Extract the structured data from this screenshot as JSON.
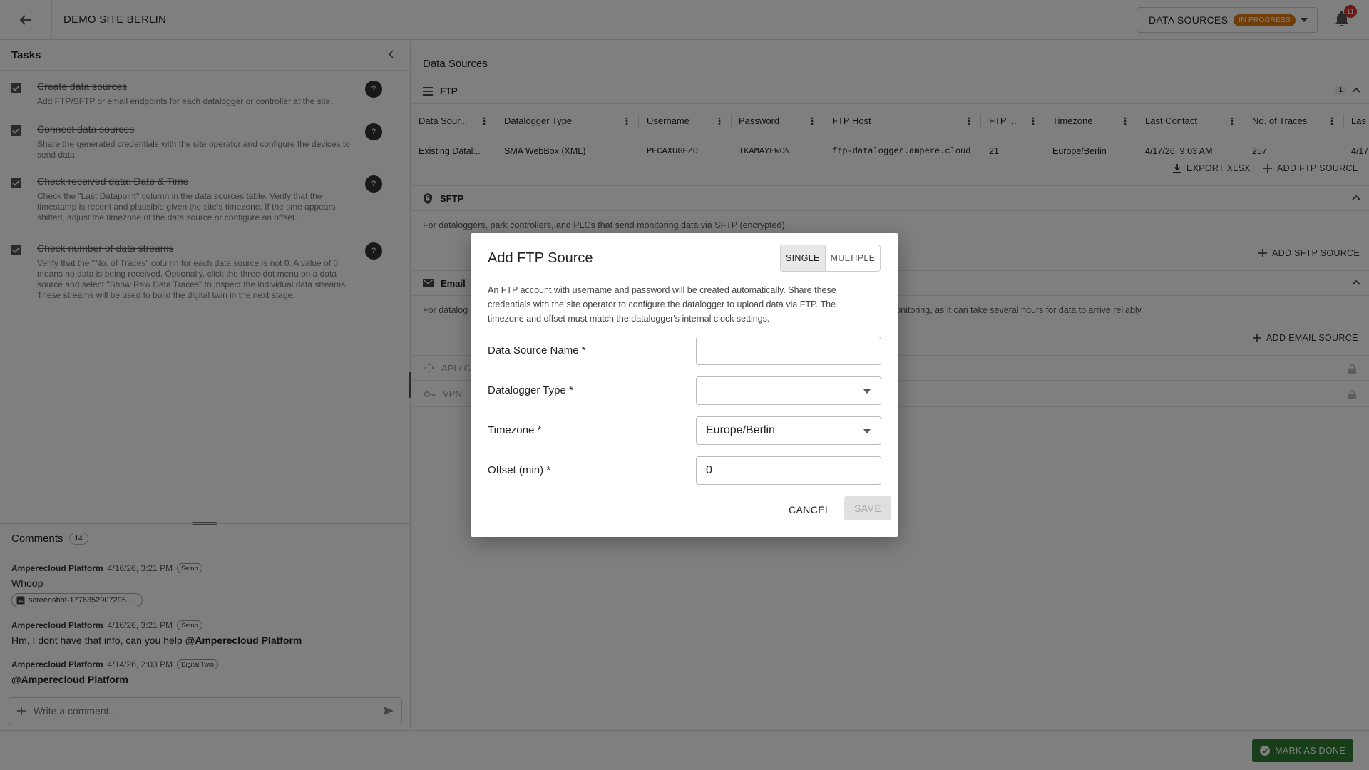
{
  "header": {
    "site_title": "DEMO SITE BERLIN",
    "stage_label": "DATA SOURCES",
    "stage_status": "IN PROGRESS",
    "notification_count": "11"
  },
  "tasks_panel": {
    "title": "Tasks",
    "items": [
      {
        "title": "Create data sources",
        "description": "Add FTP/SFTP or email endpoints for each datalogger or controller at the site.",
        "done": true
      },
      {
        "title": "Connect data sources",
        "description": "Share the generated credentials with the site operator and configure the devices to send data.",
        "done": true
      },
      {
        "title": "Check received data: Date & Time",
        "description": "Check the \"Last Datapoint\" column in the data sources table. Verify that the timestamp is recent and plausible given the site's timezone. If the time appears shifted, adjust the timezone of the data source or configure an offset.",
        "done": true
      },
      {
        "title": "Check number of data streams",
        "description": "Verify that the \"No. of Traces\" column for each data source is not 0. A value of 0 means no data is being received. Optionally, click the three-dot menu on a data source and select \"Show Raw Data Traces\" to inspect the individual data streams. These streams will be used to build the digital twin in the next stage.",
        "done": true
      }
    ],
    "help_glyph": "?"
  },
  "comments": {
    "title": "Comments",
    "count": "14",
    "items": [
      {
        "author": "Amperecloud Platform",
        "time": "4/16/26, 3:21 PM",
        "tag": "Setup",
        "text": "Whoop",
        "attachment": "screenshot-1776352907295...."
      },
      {
        "author": "Amperecloud Platform",
        "time": "4/16/26, 3:21 PM",
        "tag": "Setup",
        "text": "Hm, I dont have that info, can you help ",
        "mention": "@Amperecloud Platform"
      },
      {
        "author": "Amperecloud Platform",
        "time": "4/14/26, 2:03 PM",
        "tag": "Digital Twin",
        "mention": "@Amperecloud Platform"
      }
    ],
    "input_placeholder": "Write a comment..."
  },
  "data_sources": {
    "title": "Data Sources",
    "ftp": {
      "label": "FTP",
      "count": "1",
      "columns": [
        "Data Sour...",
        "Datalogger Type",
        "Username",
        "Password",
        "FTP Host",
        "FTP ...",
        "Timezone",
        "Last Contact",
        "No. of Traces",
        "Las"
      ],
      "rows": [
        [
          "Existing Datal...",
          "SMA WebBox (XML)",
          "PECAXUGEZO",
          "IKAMAYEWON",
          "ftp-datalogger.ampere.cloud",
          "21",
          "Europe/Berlin",
          "4/17/26, 9:03 AM",
          "257",
          "4/17"
        ]
      ],
      "export_label": "EXPORT XLSX",
      "add_label": "ADD FTP SOURCE"
    },
    "sftp": {
      "label": "SFTP",
      "description": "For dataloggers, park controllers, and PLCs that send monitoring data via SFTP (encrypted).",
      "add_label": "ADD SFTP SOURCE"
    },
    "email": {
      "label": "Email",
      "description_start": "For datalog",
      "description_end": "me monitoring, as it can take several hours for data to arrive reliably.",
      "add_label": "ADD EMAIL SOURCE"
    },
    "api": {
      "label": "API / C"
    },
    "vpn": {
      "label": "VPN"
    }
  },
  "footer": {
    "mark_done_label": "MARK AS DONE"
  },
  "dialog": {
    "title": "Add FTP Source",
    "mode_single": "SINGLE",
    "mode_multiple": "MULTIPLE",
    "description": "An FTP account with username and password will be created automatically. Share these credentials with the site operator to configure the datalogger to upload data via FTP. The timezone and offset must match the datalogger's internal clock settings.",
    "fields": {
      "name_label": "Data Source Name *",
      "name_value": "",
      "type_label": "Datalogger Type *",
      "type_value": "",
      "timezone_label": "Timezone *",
      "timezone_value": "Europe/Berlin",
      "offset_label": "Offset (min) *",
      "offset_value": "0"
    },
    "cancel_label": "CANCEL",
    "save_label": "SAVE"
  },
  "colors": {
    "status_in_progress": "#e07a10",
    "done_button": "#2e7d32",
    "notification_badge": "#d32f2f"
  }
}
